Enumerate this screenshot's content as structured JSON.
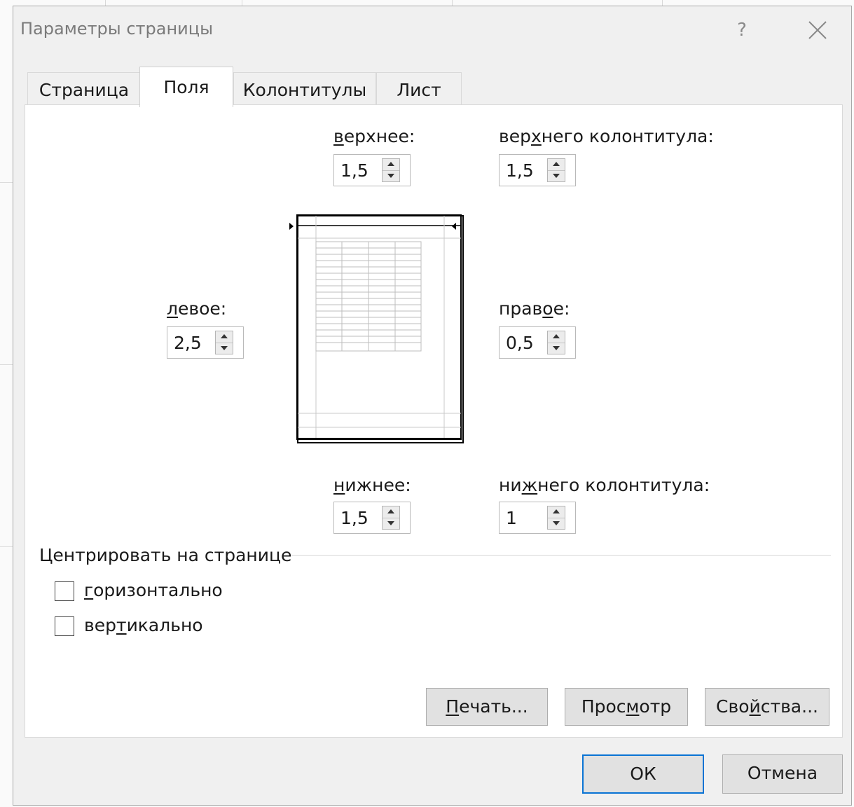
{
  "window": {
    "title": "Параметры страницы",
    "help_label": "?"
  },
  "tabs": [
    {
      "label": "Страница",
      "active": false
    },
    {
      "label": "Поля",
      "active": true
    },
    {
      "label": "Колонтитулы",
      "active": false
    },
    {
      "label": "Лист",
      "active": false
    }
  ],
  "margins": {
    "top": {
      "label_pre": "",
      "label_ul": "в",
      "label_post": "ерхнее:",
      "value": "1,5"
    },
    "header": {
      "label_pre": "вер",
      "label_ul": "х",
      "label_post": "него колонтитула:",
      "value": "1,5"
    },
    "left": {
      "label_pre": "",
      "label_ul": "л",
      "label_post": "евое:",
      "value": "2,5"
    },
    "right": {
      "label_pre": "прав",
      "label_ul": "о",
      "label_post": "е:",
      "value": "0,5"
    },
    "bottom": {
      "label_pre": "",
      "label_ul": "н",
      "label_post": "ижнее:",
      "value": "1,5"
    },
    "footer": {
      "label_pre": "ни",
      "label_ul": "ж",
      "label_post": "него колонтитула:",
      "value": "1"
    }
  },
  "center": {
    "title": "Центрировать на странице",
    "horizontal": {
      "label_pre": "",
      "label_ul": "г",
      "label_post": "оризонтально",
      "checked": false
    },
    "vertical": {
      "label_pre": "вер",
      "label_ul": "т",
      "label_post": "икально",
      "checked": false
    }
  },
  "buttons": {
    "print": {
      "pre": "",
      "ul": "П",
      "post": "ечать..."
    },
    "preview": {
      "pre": "Прос",
      "ul": "м",
      "post": "отр"
    },
    "properties": {
      "pre": "Сво",
      "ul": "й",
      "post": "ства..."
    },
    "ok": "ОК",
    "cancel": "Отмена"
  },
  "colors": {
    "dialog_bg": "#f0f0f0",
    "panel_bg": "#ffffff",
    "default_button_border": "#0a74d4",
    "title_text": "#7a7a7a"
  },
  "icons": {
    "close": "close-icon",
    "spin_up": "arrow-up-icon",
    "spin_down": "arrow-down-icon"
  }
}
